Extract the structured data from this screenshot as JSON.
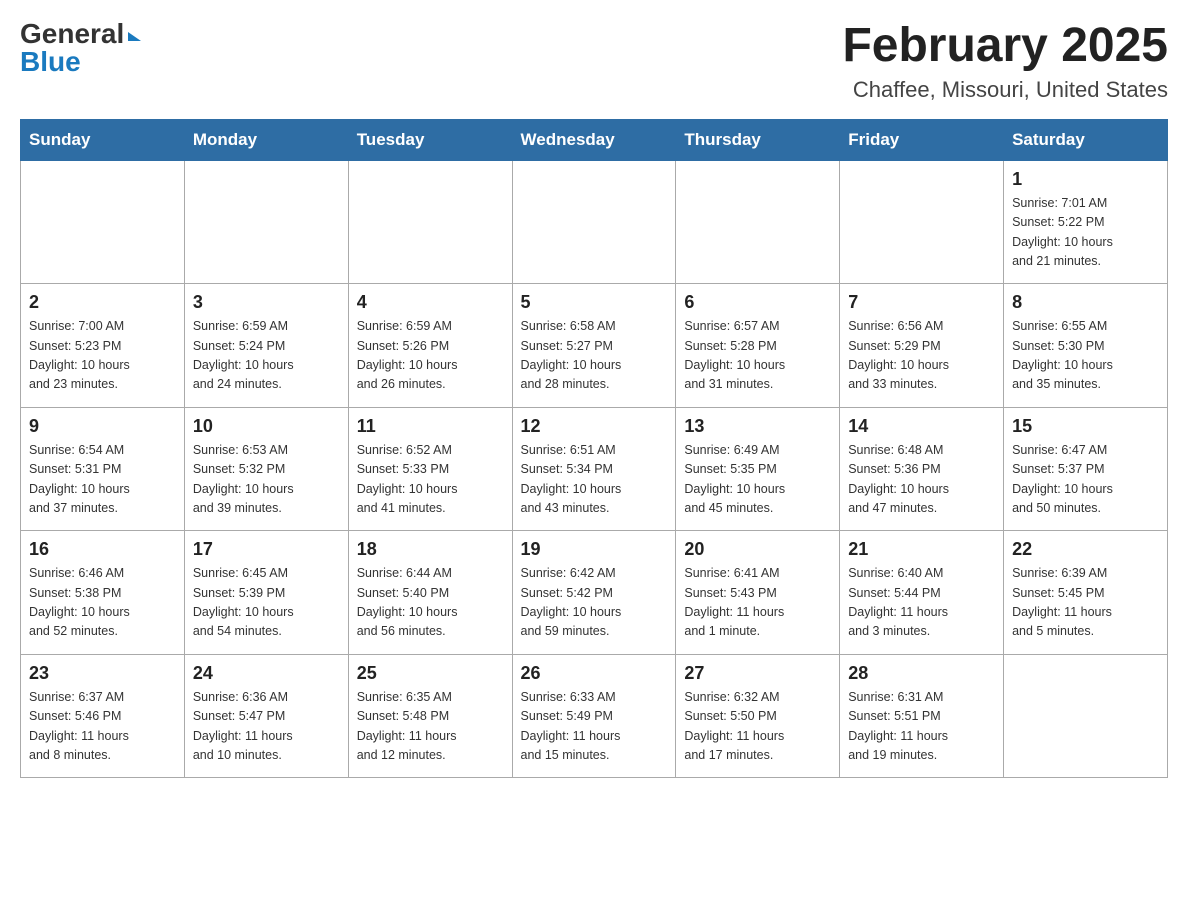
{
  "header": {
    "logo_general": "General",
    "logo_blue": "Blue",
    "month_title": "February 2025",
    "location": "Chaffee, Missouri, United States"
  },
  "weekdays": [
    "Sunday",
    "Monday",
    "Tuesday",
    "Wednesday",
    "Thursday",
    "Friday",
    "Saturday"
  ],
  "weeks": [
    [
      {
        "day": "",
        "info": ""
      },
      {
        "day": "",
        "info": ""
      },
      {
        "day": "",
        "info": ""
      },
      {
        "day": "",
        "info": ""
      },
      {
        "day": "",
        "info": ""
      },
      {
        "day": "",
        "info": ""
      },
      {
        "day": "1",
        "info": "Sunrise: 7:01 AM\nSunset: 5:22 PM\nDaylight: 10 hours\nand 21 minutes."
      }
    ],
    [
      {
        "day": "2",
        "info": "Sunrise: 7:00 AM\nSunset: 5:23 PM\nDaylight: 10 hours\nand 23 minutes."
      },
      {
        "day": "3",
        "info": "Sunrise: 6:59 AM\nSunset: 5:24 PM\nDaylight: 10 hours\nand 24 minutes."
      },
      {
        "day": "4",
        "info": "Sunrise: 6:59 AM\nSunset: 5:26 PM\nDaylight: 10 hours\nand 26 minutes."
      },
      {
        "day": "5",
        "info": "Sunrise: 6:58 AM\nSunset: 5:27 PM\nDaylight: 10 hours\nand 28 minutes."
      },
      {
        "day": "6",
        "info": "Sunrise: 6:57 AM\nSunset: 5:28 PM\nDaylight: 10 hours\nand 31 minutes."
      },
      {
        "day": "7",
        "info": "Sunrise: 6:56 AM\nSunset: 5:29 PM\nDaylight: 10 hours\nand 33 minutes."
      },
      {
        "day": "8",
        "info": "Sunrise: 6:55 AM\nSunset: 5:30 PM\nDaylight: 10 hours\nand 35 minutes."
      }
    ],
    [
      {
        "day": "9",
        "info": "Sunrise: 6:54 AM\nSunset: 5:31 PM\nDaylight: 10 hours\nand 37 minutes."
      },
      {
        "day": "10",
        "info": "Sunrise: 6:53 AM\nSunset: 5:32 PM\nDaylight: 10 hours\nand 39 minutes."
      },
      {
        "day": "11",
        "info": "Sunrise: 6:52 AM\nSunset: 5:33 PM\nDaylight: 10 hours\nand 41 minutes."
      },
      {
        "day": "12",
        "info": "Sunrise: 6:51 AM\nSunset: 5:34 PM\nDaylight: 10 hours\nand 43 minutes."
      },
      {
        "day": "13",
        "info": "Sunrise: 6:49 AM\nSunset: 5:35 PM\nDaylight: 10 hours\nand 45 minutes."
      },
      {
        "day": "14",
        "info": "Sunrise: 6:48 AM\nSunset: 5:36 PM\nDaylight: 10 hours\nand 47 minutes."
      },
      {
        "day": "15",
        "info": "Sunrise: 6:47 AM\nSunset: 5:37 PM\nDaylight: 10 hours\nand 50 minutes."
      }
    ],
    [
      {
        "day": "16",
        "info": "Sunrise: 6:46 AM\nSunset: 5:38 PM\nDaylight: 10 hours\nand 52 minutes."
      },
      {
        "day": "17",
        "info": "Sunrise: 6:45 AM\nSunset: 5:39 PM\nDaylight: 10 hours\nand 54 minutes."
      },
      {
        "day": "18",
        "info": "Sunrise: 6:44 AM\nSunset: 5:40 PM\nDaylight: 10 hours\nand 56 minutes."
      },
      {
        "day": "19",
        "info": "Sunrise: 6:42 AM\nSunset: 5:42 PM\nDaylight: 10 hours\nand 59 minutes."
      },
      {
        "day": "20",
        "info": "Sunrise: 6:41 AM\nSunset: 5:43 PM\nDaylight: 11 hours\nand 1 minute."
      },
      {
        "day": "21",
        "info": "Sunrise: 6:40 AM\nSunset: 5:44 PM\nDaylight: 11 hours\nand 3 minutes."
      },
      {
        "day": "22",
        "info": "Sunrise: 6:39 AM\nSunset: 5:45 PM\nDaylight: 11 hours\nand 5 minutes."
      }
    ],
    [
      {
        "day": "23",
        "info": "Sunrise: 6:37 AM\nSunset: 5:46 PM\nDaylight: 11 hours\nand 8 minutes."
      },
      {
        "day": "24",
        "info": "Sunrise: 6:36 AM\nSunset: 5:47 PM\nDaylight: 11 hours\nand 10 minutes."
      },
      {
        "day": "25",
        "info": "Sunrise: 6:35 AM\nSunset: 5:48 PM\nDaylight: 11 hours\nand 12 minutes."
      },
      {
        "day": "26",
        "info": "Sunrise: 6:33 AM\nSunset: 5:49 PM\nDaylight: 11 hours\nand 15 minutes."
      },
      {
        "day": "27",
        "info": "Sunrise: 6:32 AM\nSunset: 5:50 PM\nDaylight: 11 hours\nand 17 minutes."
      },
      {
        "day": "28",
        "info": "Sunrise: 6:31 AM\nSunset: 5:51 PM\nDaylight: 11 hours\nand 19 minutes."
      },
      {
        "day": "",
        "info": ""
      }
    ]
  ]
}
